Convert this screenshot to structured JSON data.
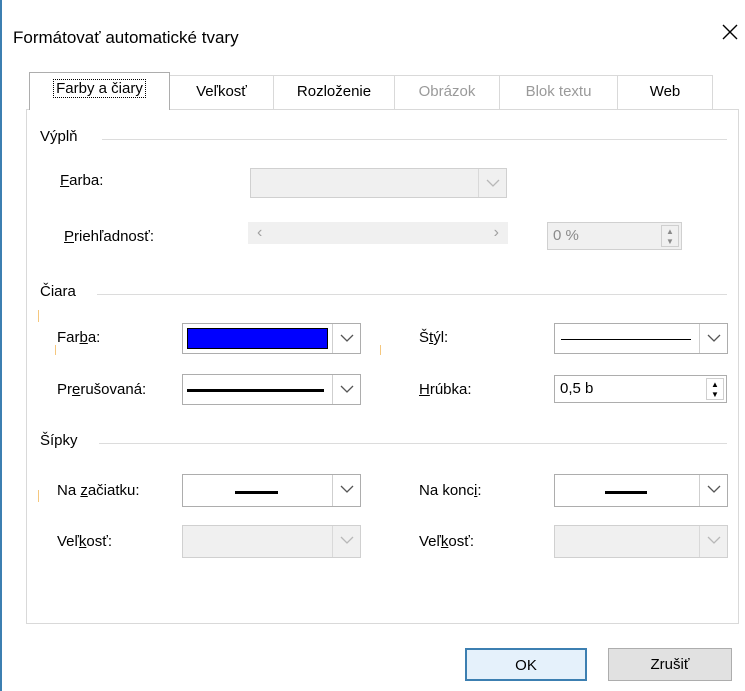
{
  "window": {
    "title": "Formátovať automatické tvary"
  },
  "tabs": [
    {
      "label": "Farby a čiary",
      "state": "active"
    },
    {
      "label": "Veľkosť",
      "state": "normal"
    },
    {
      "label": "Rozloženie",
      "state": "normal"
    },
    {
      "label": "Obrázok",
      "state": "disabled"
    },
    {
      "label": "Blok textu",
      "state": "disabled"
    },
    {
      "label": "Web",
      "state": "normal"
    }
  ],
  "fill": {
    "section": "Výplň",
    "color_label_pre": "",
    "color_label_u": "F",
    "color_label_post": "arba:",
    "transparency_label_pre": "",
    "transparency_label_u": "P",
    "transparency_label_post": "riehľadnosť:",
    "transparency_value": "0 %"
  },
  "line": {
    "section": "Čiara",
    "color_label_pre": "Far",
    "color_label_u": "b",
    "color_label_post": "a:",
    "color_value": "#0000ff",
    "dashed_label_pre": "Pr",
    "dashed_label_u": "e",
    "dashed_label_post": "rušovaná:",
    "style_label_pre": "Š",
    "style_label_u": "t",
    "style_label_post": "ýl:",
    "weight_label_pre": "",
    "weight_label_u": "H",
    "weight_label_post": "rúbka:",
    "weight_value": "0,5 b"
  },
  "arrows": {
    "section": "Šípky",
    "begin_label_pre": "Na ",
    "begin_label_u": "z",
    "begin_label_post": "ačiatku:",
    "end_label_pre": "Na konc",
    "end_label_u": "i",
    "end_label_post": ":",
    "begin_size_label_pre": "Veľ",
    "begin_size_label_u": "k",
    "begin_size_label_post": "osť:",
    "end_size_label_pre": "Veľ",
    "end_size_label_u": "k",
    "end_size_label_post": "osť:"
  },
  "buttons": {
    "ok": "OK",
    "cancel": "Zrušiť"
  },
  "colors": {
    "accent": "#3c7fb1",
    "line_color": "#0000ff"
  }
}
